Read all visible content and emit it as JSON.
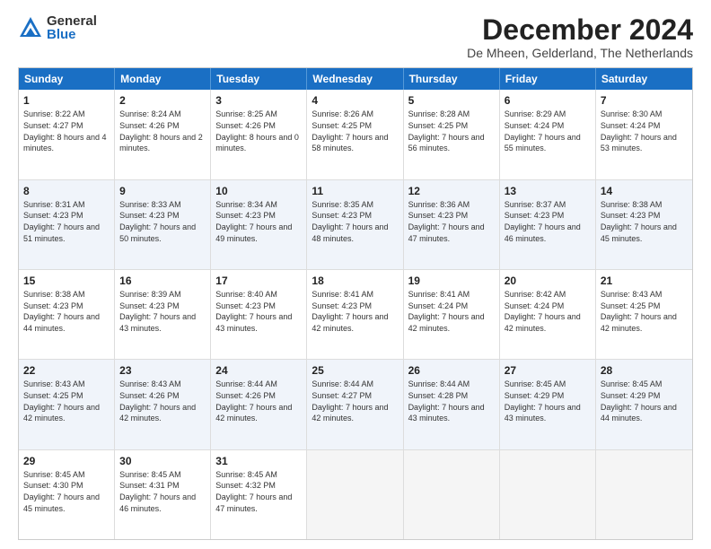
{
  "logo": {
    "general": "General",
    "blue": "Blue"
  },
  "title": "December 2024",
  "location": "De Mheen, Gelderland, The Netherlands",
  "header_days": [
    "Sunday",
    "Monday",
    "Tuesday",
    "Wednesday",
    "Thursday",
    "Friday",
    "Saturday"
  ],
  "weeks": [
    [
      {
        "day": "1",
        "sunrise": "Sunrise: 8:22 AM",
        "sunset": "Sunset: 4:27 PM",
        "daylight": "Daylight: 8 hours and 4 minutes."
      },
      {
        "day": "2",
        "sunrise": "Sunrise: 8:24 AM",
        "sunset": "Sunset: 4:26 PM",
        "daylight": "Daylight: 8 hours and 2 minutes."
      },
      {
        "day": "3",
        "sunrise": "Sunrise: 8:25 AM",
        "sunset": "Sunset: 4:26 PM",
        "daylight": "Daylight: 8 hours and 0 minutes."
      },
      {
        "day": "4",
        "sunrise": "Sunrise: 8:26 AM",
        "sunset": "Sunset: 4:25 PM",
        "daylight": "Daylight: 7 hours and 58 minutes."
      },
      {
        "day": "5",
        "sunrise": "Sunrise: 8:28 AM",
        "sunset": "Sunset: 4:25 PM",
        "daylight": "Daylight: 7 hours and 56 minutes."
      },
      {
        "day": "6",
        "sunrise": "Sunrise: 8:29 AM",
        "sunset": "Sunset: 4:24 PM",
        "daylight": "Daylight: 7 hours and 55 minutes."
      },
      {
        "day": "7",
        "sunrise": "Sunrise: 8:30 AM",
        "sunset": "Sunset: 4:24 PM",
        "daylight": "Daylight: 7 hours and 53 minutes."
      }
    ],
    [
      {
        "day": "8",
        "sunrise": "Sunrise: 8:31 AM",
        "sunset": "Sunset: 4:23 PM",
        "daylight": "Daylight: 7 hours and 51 minutes."
      },
      {
        "day": "9",
        "sunrise": "Sunrise: 8:33 AM",
        "sunset": "Sunset: 4:23 PM",
        "daylight": "Daylight: 7 hours and 50 minutes."
      },
      {
        "day": "10",
        "sunrise": "Sunrise: 8:34 AM",
        "sunset": "Sunset: 4:23 PM",
        "daylight": "Daylight: 7 hours and 49 minutes."
      },
      {
        "day": "11",
        "sunrise": "Sunrise: 8:35 AM",
        "sunset": "Sunset: 4:23 PM",
        "daylight": "Daylight: 7 hours and 48 minutes."
      },
      {
        "day": "12",
        "sunrise": "Sunrise: 8:36 AM",
        "sunset": "Sunset: 4:23 PM",
        "daylight": "Daylight: 7 hours and 47 minutes."
      },
      {
        "day": "13",
        "sunrise": "Sunrise: 8:37 AM",
        "sunset": "Sunset: 4:23 PM",
        "daylight": "Daylight: 7 hours and 46 minutes."
      },
      {
        "day": "14",
        "sunrise": "Sunrise: 8:38 AM",
        "sunset": "Sunset: 4:23 PM",
        "daylight": "Daylight: 7 hours and 45 minutes."
      }
    ],
    [
      {
        "day": "15",
        "sunrise": "Sunrise: 8:38 AM",
        "sunset": "Sunset: 4:23 PM",
        "daylight": "Daylight: 7 hours and 44 minutes."
      },
      {
        "day": "16",
        "sunrise": "Sunrise: 8:39 AM",
        "sunset": "Sunset: 4:23 PM",
        "daylight": "Daylight: 7 hours and 43 minutes."
      },
      {
        "day": "17",
        "sunrise": "Sunrise: 8:40 AM",
        "sunset": "Sunset: 4:23 PM",
        "daylight": "Daylight: 7 hours and 43 minutes."
      },
      {
        "day": "18",
        "sunrise": "Sunrise: 8:41 AM",
        "sunset": "Sunset: 4:23 PM",
        "daylight": "Daylight: 7 hours and 42 minutes."
      },
      {
        "day": "19",
        "sunrise": "Sunrise: 8:41 AM",
        "sunset": "Sunset: 4:24 PM",
        "daylight": "Daylight: 7 hours and 42 minutes."
      },
      {
        "day": "20",
        "sunrise": "Sunrise: 8:42 AM",
        "sunset": "Sunset: 4:24 PM",
        "daylight": "Daylight: 7 hours and 42 minutes."
      },
      {
        "day": "21",
        "sunrise": "Sunrise: 8:43 AM",
        "sunset": "Sunset: 4:25 PM",
        "daylight": "Daylight: 7 hours and 42 minutes."
      }
    ],
    [
      {
        "day": "22",
        "sunrise": "Sunrise: 8:43 AM",
        "sunset": "Sunset: 4:25 PM",
        "daylight": "Daylight: 7 hours and 42 minutes."
      },
      {
        "day": "23",
        "sunrise": "Sunrise: 8:43 AM",
        "sunset": "Sunset: 4:26 PM",
        "daylight": "Daylight: 7 hours and 42 minutes."
      },
      {
        "day": "24",
        "sunrise": "Sunrise: 8:44 AM",
        "sunset": "Sunset: 4:26 PM",
        "daylight": "Daylight: 7 hours and 42 minutes."
      },
      {
        "day": "25",
        "sunrise": "Sunrise: 8:44 AM",
        "sunset": "Sunset: 4:27 PM",
        "daylight": "Daylight: 7 hours and 42 minutes."
      },
      {
        "day": "26",
        "sunrise": "Sunrise: 8:44 AM",
        "sunset": "Sunset: 4:28 PM",
        "daylight": "Daylight: 7 hours and 43 minutes."
      },
      {
        "day": "27",
        "sunrise": "Sunrise: 8:45 AM",
        "sunset": "Sunset: 4:29 PM",
        "daylight": "Daylight: 7 hours and 43 minutes."
      },
      {
        "day": "28",
        "sunrise": "Sunrise: 8:45 AM",
        "sunset": "Sunset: 4:29 PM",
        "daylight": "Daylight: 7 hours and 44 minutes."
      }
    ],
    [
      {
        "day": "29",
        "sunrise": "Sunrise: 8:45 AM",
        "sunset": "Sunset: 4:30 PM",
        "daylight": "Daylight: 7 hours and 45 minutes."
      },
      {
        "day": "30",
        "sunrise": "Sunrise: 8:45 AM",
        "sunset": "Sunset: 4:31 PM",
        "daylight": "Daylight: 7 hours and 46 minutes."
      },
      {
        "day": "31",
        "sunrise": "Sunrise: 8:45 AM",
        "sunset": "Sunset: 4:32 PM",
        "daylight": "Daylight: 7 hours and 47 minutes."
      },
      null,
      null,
      null,
      null
    ]
  ]
}
